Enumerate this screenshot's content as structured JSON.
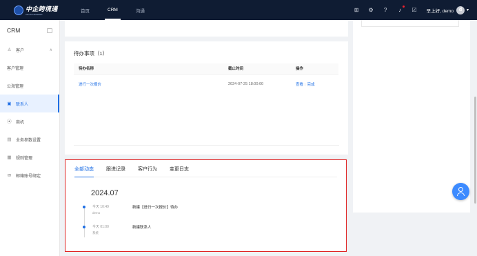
{
  "brand": {
    "name": "中企跨境通",
    "sub": "CROSS-BORDER"
  },
  "topnav": [
    {
      "label": "首页",
      "active": false
    },
    {
      "label": "CRM",
      "active": true
    },
    {
      "label": "沟通",
      "active": false
    }
  ],
  "header": {
    "greeting": "早上好, demo",
    "avatar_letter": "d",
    "icons": [
      "expand-icon",
      "gear-icon",
      "help-icon",
      "bell-icon",
      "checkbox-icon"
    ]
  },
  "sidebar": {
    "title": "CRM",
    "items": [
      {
        "label": "客户",
        "icon": "user-icon",
        "chevron": "∧",
        "active": false
      },
      {
        "label": "客户管理",
        "active": false
      },
      {
        "label": "公海管理",
        "active": false
      },
      {
        "label": "联系人",
        "icon": "contact-card-icon",
        "active": true
      },
      {
        "label": "商机",
        "icon": "location-icon",
        "active": false
      },
      {
        "label": "业务参数设置",
        "icon": "settings-doc-icon",
        "chevron": "∨",
        "active": false
      },
      {
        "label": "规则管理",
        "icon": "rules-icon",
        "active": false
      },
      {
        "label": "邮箱账号绑定",
        "icon": "mail-icon",
        "active": false
      }
    ]
  },
  "todo": {
    "title": "待办事项（1）",
    "columns": [
      "待办名称",
      "截止时间",
      "操作"
    ],
    "rows": [
      {
        "name": "进行一次报价",
        "deadline": "2024-07-25 18:00:00",
        "view": "查看",
        "done": "完成"
      }
    ]
  },
  "activity": {
    "tabs": [
      {
        "label": "全部动态",
        "active": true
      },
      {
        "label": "跟进记录",
        "active": false
      },
      {
        "label": "客户行为",
        "active": false
      },
      {
        "label": "变更日志",
        "active": false
      }
    ],
    "period": "2024.07",
    "items": [
      {
        "time": "今天 10:49",
        "user": "demo",
        "text": "新建【进行一次报价】待办"
      },
      {
        "time": "今天 01:00",
        "user": "系统",
        "text": "新建联系人"
      }
    ]
  },
  "colors": {
    "accent": "#1f6fe5",
    "topbar": "#0f1c33",
    "highlight_border": "#e02424"
  }
}
